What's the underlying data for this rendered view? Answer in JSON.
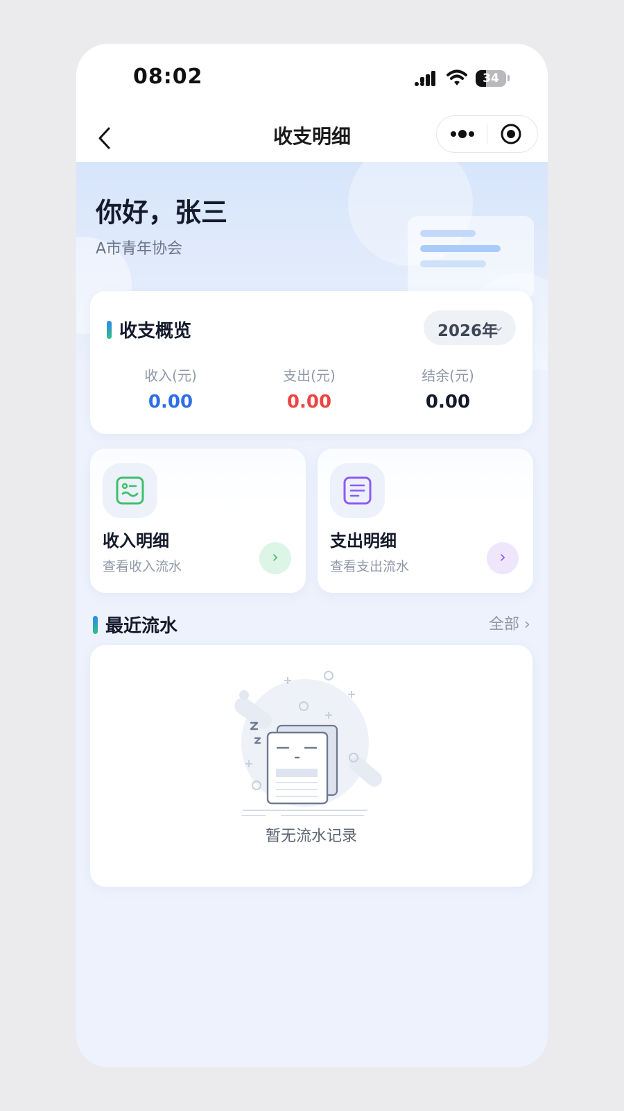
{
  "status_bar": {
    "time": "08:02",
    "battery_level": "34",
    "battery_fraction": 0.34
  },
  "nav": {
    "title": "收支明细",
    "more_icon": "more-dots-icon",
    "target_icon": "target-circle-icon",
    "back_icon": "chevron-left-icon"
  },
  "hero": {
    "greeting": "你好，张三",
    "organization": "A市青年协会"
  },
  "overview": {
    "title": "收支概览",
    "year": "2026年",
    "stats": [
      {
        "label": "收入(元)",
        "value": "0.00",
        "color": "#2e6ee6"
      },
      {
        "label": "支出(元)",
        "value": "0.00",
        "color": "#ef4444"
      },
      {
        "label": "结余(元)",
        "value": "0.00",
        "color": "#131a2b"
      }
    ]
  },
  "details": [
    {
      "title": "收入明细",
      "subtitle": "查看收入流水",
      "icon": "income-list-icon",
      "accent": "#3fc06a",
      "button_bg": "#dcf5e6",
      "arrow": "›"
    },
    {
      "title": "支出明细",
      "subtitle": "查看支出流水",
      "icon": "expense-list-icon",
      "accent": "#8b5cf6",
      "button_bg": "#efe6fb",
      "arrow": "›"
    }
  ],
  "recent": {
    "title": "最近流水",
    "view_all": "全部 ›",
    "empty_text": "暂无流水记录",
    "empty_icon": "empty-documents-icon"
  }
}
